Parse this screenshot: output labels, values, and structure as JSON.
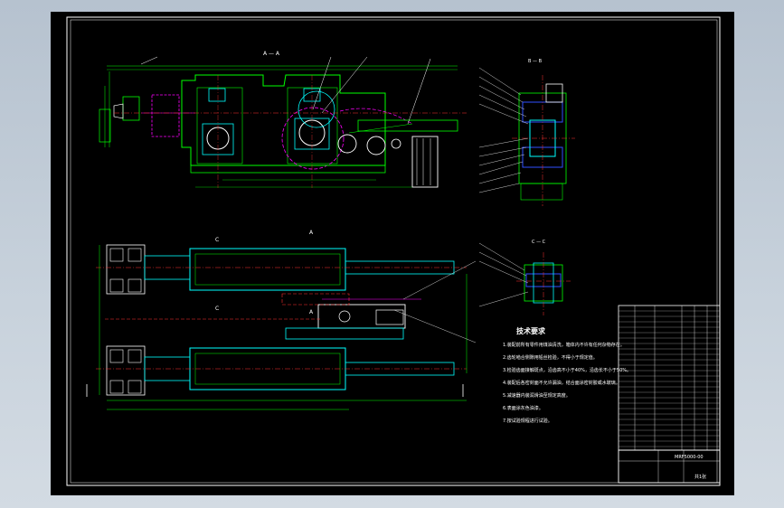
{
  "drawing": {
    "views": {
      "section_a": "A — A",
      "section_b": "B — B",
      "section_c": "C — C"
    },
    "section_markers": [
      "A",
      "A",
      "C",
      "C"
    ],
    "technical_requirements": {
      "title": "技术要求",
      "items": [
        "1.装配前所有零件用煤油清洗，箱体内不许有任何杂物存在。",
        "2.齿轮啮合侧隙用铅丝检验，不得小于规定值。",
        "3.检验齿面接触斑点，沿齿高不小于40%，沿齿长不小于50%。",
        "4.装配后各密封面不允许漏油，结合面涂密封胶或水玻璃。",
        "5.减速器内装润滑油至规定高度。",
        "6.表面涂灰色油漆。",
        "7.按试验规程进行试验。"
      ]
    },
    "title_block": {
      "drawing_number": "MRF5000-00",
      "sheet": "共1张"
    }
  },
  "colors": {
    "background": "#000000",
    "frame": "#ffffff",
    "outline": "#00ff00",
    "part": "#00ffff",
    "centerline": "#ff3030",
    "hidden": "#ff00ff",
    "leader": "#ffffff",
    "blue": "#3050ff"
  }
}
